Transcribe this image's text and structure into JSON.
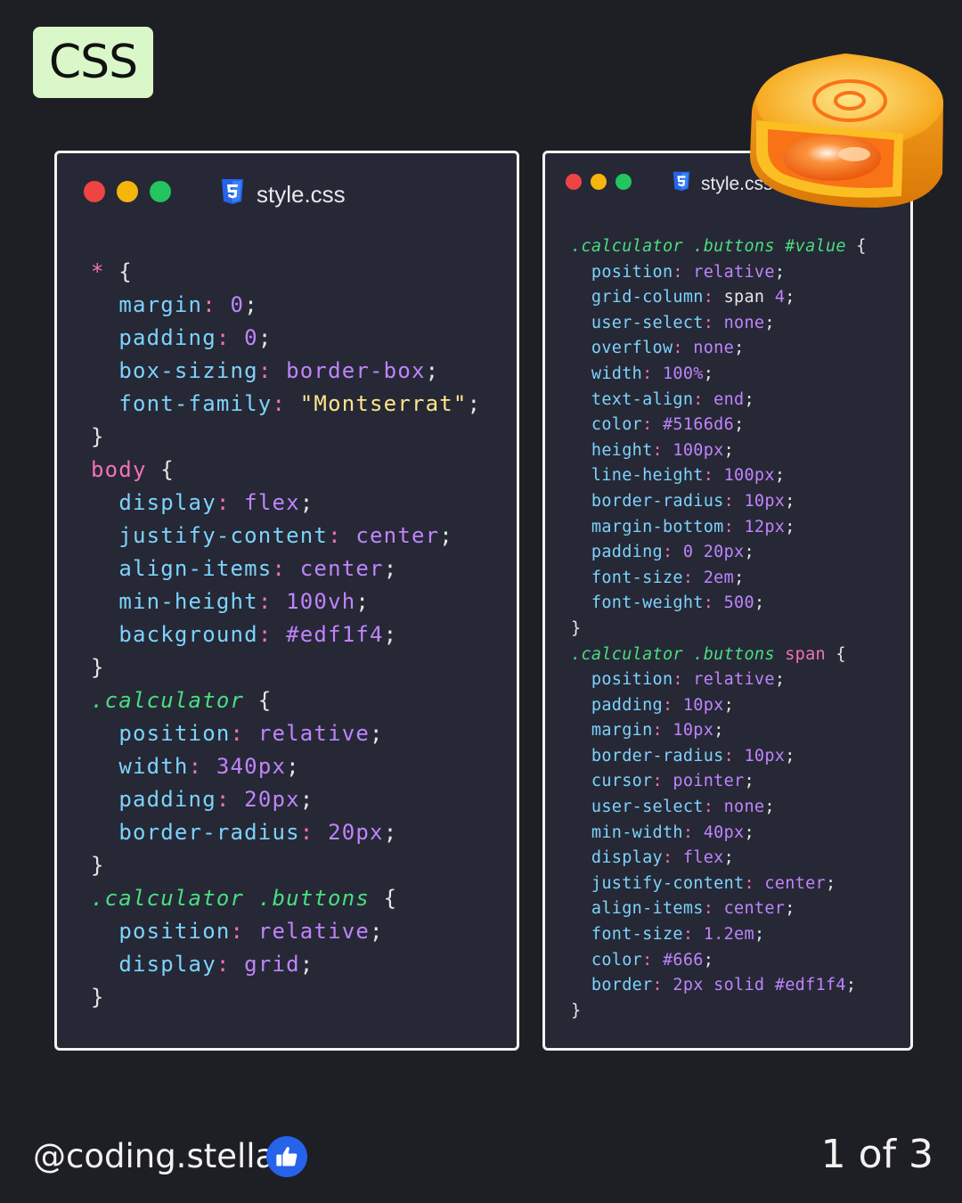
{
  "badge": {
    "label": "CSS"
  },
  "colors": {
    "background": "#1e1f24",
    "window_bg": "#262836",
    "dot_red": "#ef4444",
    "dot_yellow": "#f5b50a",
    "dot_green": "#22c55e",
    "selector": "#f472b6",
    "class": "#4ade80",
    "property": "#7dd3fc",
    "value": "#c084fc",
    "string": "#fde68a"
  },
  "windows": [
    {
      "filename": "style.css",
      "lines": [
        [
          [
            "sel",
            "*"
          ],
          [
            "plain",
            " {"
          ]
        ],
        [
          [
            "plain",
            "  "
          ],
          [
            "prop",
            "margin"
          ],
          [
            "colon",
            ": "
          ],
          [
            "val",
            "0"
          ],
          [
            "plain",
            ";"
          ]
        ],
        [
          [
            "plain",
            "  "
          ],
          [
            "prop",
            "padding"
          ],
          [
            "colon",
            ": "
          ],
          [
            "val",
            "0"
          ],
          [
            "plain",
            ";"
          ]
        ],
        [
          [
            "plain",
            "  "
          ],
          [
            "prop",
            "box-sizing"
          ],
          [
            "colon",
            ": "
          ],
          [
            "val",
            "border-box"
          ],
          [
            "plain",
            ";"
          ]
        ],
        [
          [
            "plain",
            "  "
          ],
          [
            "prop",
            "font-family"
          ],
          [
            "colon",
            ": "
          ],
          [
            "str",
            "\"Montserrat\""
          ],
          [
            "plain",
            ";"
          ]
        ],
        [
          [
            "plain",
            "}"
          ]
        ],
        [
          [
            "sel",
            "body"
          ],
          [
            "plain",
            " {"
          ]
        ],
        [
          [
            "plain",
            "  "
          ],
          [
            "prop",
            "display"
          ],
          [
            "colon",
            ": "
          ],
          [
            "val",
            "flex"
          ],
          [
            "plain",
            ";"
          ]
        ],
        [
          [
            "plain",
            "  "
          ],
          [
            "prop",
            "justify-content"
          ],
          [
            "colon",
            ": "
          ],
          [
            "val",
            "center"
          ],
          [
            "plain",
            ";"
          ]
        ],
        [
          [
            "plain",
            "  "
          ],
          [
            "prop",
            "align-items"
          ],
          [
            "colon",
            ": "
          ],
          [
            "val",
            "center"
          ],
          [
            "plain",
            ";"
          ]
        ],
        [
          [
            "plain",
            "  "
          ],
          [
            "prop",
            "min-height"
          ],
          [
            "colon",
            ": "
          ],
          [
            "val",
            "100vh"
          ],
          [
            "plain",
            ";"
          ]
        ],
        [
          [
            "plain",
            "  "
          ],
          [
            "prop",
            "background"
          ],
          [
            "colon",
            ": "
          ],
          [
            "val",
            "#edf1f4"
          ],
          [
            "plain",
            ";"
          ]
        ],
        [
          [
            "plain",
            "}"
          ]
        ],
        [
          [
            "cls",
            ".calculator"
          ],
          [
            "plain",
            " {"
          ]
        ],
        [
          [
            "plain",
            "  "
          ],
          [
            "prop",
            "position"
          ],
          [
            "colon",
            ": "
          ],
          [
            "val",
            "relative"
          ],
          [
            "plain",
            ";"
          ]
        ],
        [
          [
            "plain",
            "  "
          ],
          [
            "prop",
            "width"
          ],
          [
            "colon",
            ": "
          ],
          [
            "val",
            "340px"
          ],
          [
            "plain",
            ";"
          ]
        ],
        [
          [
            "plain",
            "  "
          ],
          [
            "prop",
            "padding"
          ],
          [
            "colon",
            ": "
          ],
          [
            "val",
            "20px"
          ],
          [
            "plain",
            ";"
          ]
        ],
        [
          [
            "plain",
            "  "
          ],
          [
            "prop",
            "border-radius"
          ],
          [
            "colon",
            ": "
          ],
          [
            "val",
            "20px"
          ],
          [
            "plain",
            ";"
          ]
        ],
        [
          [
            "plain",
            "}"
          ]
        ],
        [
          [
            "cls",
            ".calculator .buttons"
          ],
          [
            "plain",
            " {"
          ]
        ],
        [
          [
            "plain",
            "  "
          ],
          [
            "prop",
            "position"
          ],
          [
            "colon",
            ": "
          ],
          [
            "val",
            "relative"
          ],
          [
            "plain",
            ";"
          ]
        ],
        [
          [
            "plain",
            "  "
          ],
          [
            "prop",
            "display"
          ],
          [
            "colon",
            ": "
          ],
          [
            "val",
            "grid"
          ],
          [
            "plain",
            ";"
          ]
        ],
        [
          [
            "plain",
            "}"
          ]
        ]
      ]
    },
    {
      "filename": "style.css",
      "lines": [
        [
          [
            "cls",
            ".calculator .buttons #value"
          ],
          [
            "plain",
            " {"
          ]
        ],
        [
          [
            "plain",
            "  "
          ],
          [
            "prop",
            "position"
          ],
          [
            "colon",
            ": "
          ],
          [
            "val",
            "relative"
          ],
          [
            "plain",
            ";"
          ]
        ],
        [
          [
            "plain",
            "  "
          ],
          [
            "prop",
            "grid-column"
          ],
          [
            "colon",
            ": "
          ],
          [
            "plain",
            "span "
          ],
          [
            "val",
            "4"
          ],
          [
            "plain",
            ";"
          ]
        ],
        [
          [
            "plain",
            "  "
          ],
          [
            "prop",
            "user-select"
          ],
          [
            "colon",
            ": "
          ],
          [
            "val",
            "none"
          ],
          [
            "plain",
            ";"
          ]
        ],
        [
          [
            "plain",
            "  "
          ],
          [
            "prop",
            "overflow"
          ],
          [
            "colon",
            ": "
          ],
          [
            "val",
            "none"
          ],
          [
            "plain",
            ";"
          ]
        ],
        [
          [
            "plain",
            "  "
          ],
          [
            "prop",
            "width"
          ],
          [
            "colon",
            ": "
          ],
          [
            "val",
            "100%"
          ],
          [
            "plain",
            ";"
          ]
        ],
        [
          [
            "plain",
            "  "
          ],
          [
            "prop",
            "text-align"
          ],
          [
            "colon",
            ": "
          ],
          [
            "val",
            "end"
          ],
          [
            "plain",
            ";"
          ]
        ],
        [
          [
            "plain",
            "  "
          ],
          [
            "prop",
            "color"
          ],
          [
            "colon",
            ": "
          ],
          [
            "val",
            "#5166d6"
          ],
          [
            "plain",
            ";"
          ]
        ],
        [
          [
            "plain",
            "  "
          ],
          [
            "prop",
            "height"
          ],
          [
            "colon",
            ": "
          ],
          [
            "val",
            "100px"
          ],
          [
            "plain",
            ";"
          ]
        ],
        [
          [
            "plain",
            "  "
          ],
          [
            "prop",
            "line-height"
          ],
          [
            "colon",
            ": "
          ],
          [
            "val",
            "100px"
          ],
          [
            "plain",
            ";"
          ]
        ],
        [
          [
            "plain",
            "  "
          ],
          [
            "prop",
            "border-radius"
          ],
          [
            "colon",
            ": "
          ],
          [
            "val",
            "10px"
          ],
          [
            "plain",
            ";"
          ]
        ],
        [
          [
            "plain",
            "  "
          ],
          [
            "prop",
            "margin-bottom"
          ],
          [
            "colon",
            ": "
          ],
          [
            "val",
            "12px"
          ],
          [
            "plain",
            ";"
          ]
        ],
        [
          [
            "plain",
            "  "
          ],
          [
            "prop",
            "padding"
          ],
          [
            "colon",
            ": "
          ],
          [
            "val",
            "0 20px"
          ],
          [
            "plain",
            ";"
          ]
        ],
        [
          [
            "plain",
            "  "
          ],
          [
            "prop",
            "font-size"
          ],
          [
            "colon",
            ": "
          ],
          [
            "val",
            "2em"
          ],
          [
            "plain",
            ";"
          ]
        ],
        [
          [
            "plain",
            "  "
          ],
          [
            "prop",
            "font-weight"
          ],
          [
            "colon",
            ": "
          ],
          [
            "val",
            "500"
          ],
          [
            "plain",
            ";"
          ]
        ],
        [
          [
            "plain",
            "}"
          ]
        ],
        [
          [
            "cls",
            ".calculator .buttons"
          ],
          [
            "sel",
            " span"
          ],
          [
            "plain",
            " {"
          ]
        ],
        [
          [
            "plain",
            "  "
          ],
          [
            "prop",
            "position"
          ],
          [
            "colon",
            ": "
          ],
          [
            "val",
            "relative"
          ],
          [
            "plain",
            ";"
          ]
        ],
        [
          [
            "plain",
            "  "
          ],
          [
            "prop",
            "padding"
          ],
          [
            "colon",
            ": "
          ],
          [
            "val",
            "10px"
          ],
          [
            "plain",
            ";"
          ]
        ],
        [
          [
            "plain",
            "  "
          ],
          [
            "prop",
            "margin"
          ],
          [
            "colon",
            ": "
          ],
          [
            "val",
            "10px"
          ],
          [
            "plain",
            ";"
          ]
        ],
        [
          [
            "plain",
            "  "
          ],
          [
            "prop",
            "border-radius"
          ],
          [
            "colon",
            ": "
          ],
          [
            "val",
            "10px"
          ],
          [
            "plain",
            ";"
          ]
        ],
        [
          [
            "plain",
            "  "
          ],
          [
            "prop",
            "cursor"
          ],
          [
            "colon",
            ": "
          ],
          [
            "val",
            "pointer"
          ],
          [
            "plain",
            ";"
          ]
        ],
        [
          [
            "plain",
            "  "
          ],
          [
            "prop",
            "user-select"
          ],
          [
            "colon",
            ": "
          ],
          [
            "val",
            "none"
          ],
          [
            "plain",
            ";"
          ]
        ],
        [
          [
            "plain",
            "  "
          ],
          [
            "prop",
            "min-width"
          ],
          [
            "colon",
            ": "
          ],
          [
            "val",
            "40px"
          ],
          [
            "plain",
            ";"
          ]
        ],
        [
          [
            "plain",
            "  "
          ],
          [
            "prop",
            "display"
          ],
          [
            "colon",
            ": "
          ],
          [
            "val",
            "flex"
          ],
          [
            "plain",
            ";"
          ]
        ],
        [
          [
            "plain",
            "  "
          ],
          [
            "prop",
            "justify-content"
          ],
          [
            "colon",
            ": "
          ],
          [
            "val",
            "center"
          ],
          [
            "plain",
            ";"
          ]
        ],
        [
          [
            "plain",
            "  "
          ],
          [
            "prop",
            "align-items"
          ],
          [
            "colon",
            ": "
          ],
          [
            "val",
            "center"
          ],
          [
            "plain",
            ";"
          ]
        ],
        [
          [
            "plain",
            "  "
          ],
          [
            "prop",
            "font-size"
          ],
          [
            "colon",
            ": "
          ],
          [
            "val",
            "1.2em"
          ],
          [
            "plain",
            ";"
          ]
        ],
        [
          [
            "plain",
            "  "
          ],
          [
            "prop",
            "color"
          ],
          [
            "colon",
            ": "
          ],
          [
            "val",
            "#666"
          ],
          [
            "plain",
            ";"
          ]
        ],
        [
          [
            "plain",
            "  "
          ],
          [
            "prop",
            "border"
          ],
          [
            "colon",
            ": "
          ],
          [
            "val",
            "2px solid #edf1f4"
          ],
          [
            "plain",
            ";"
          ]
        ],
        [
          [
            "plain",
            "}"
          ]
        ]
      ]
    }
  ],
  "footer": {
    "handle": "@coding.stella",
    "page_indicator": "1 of 3"
  }
}
